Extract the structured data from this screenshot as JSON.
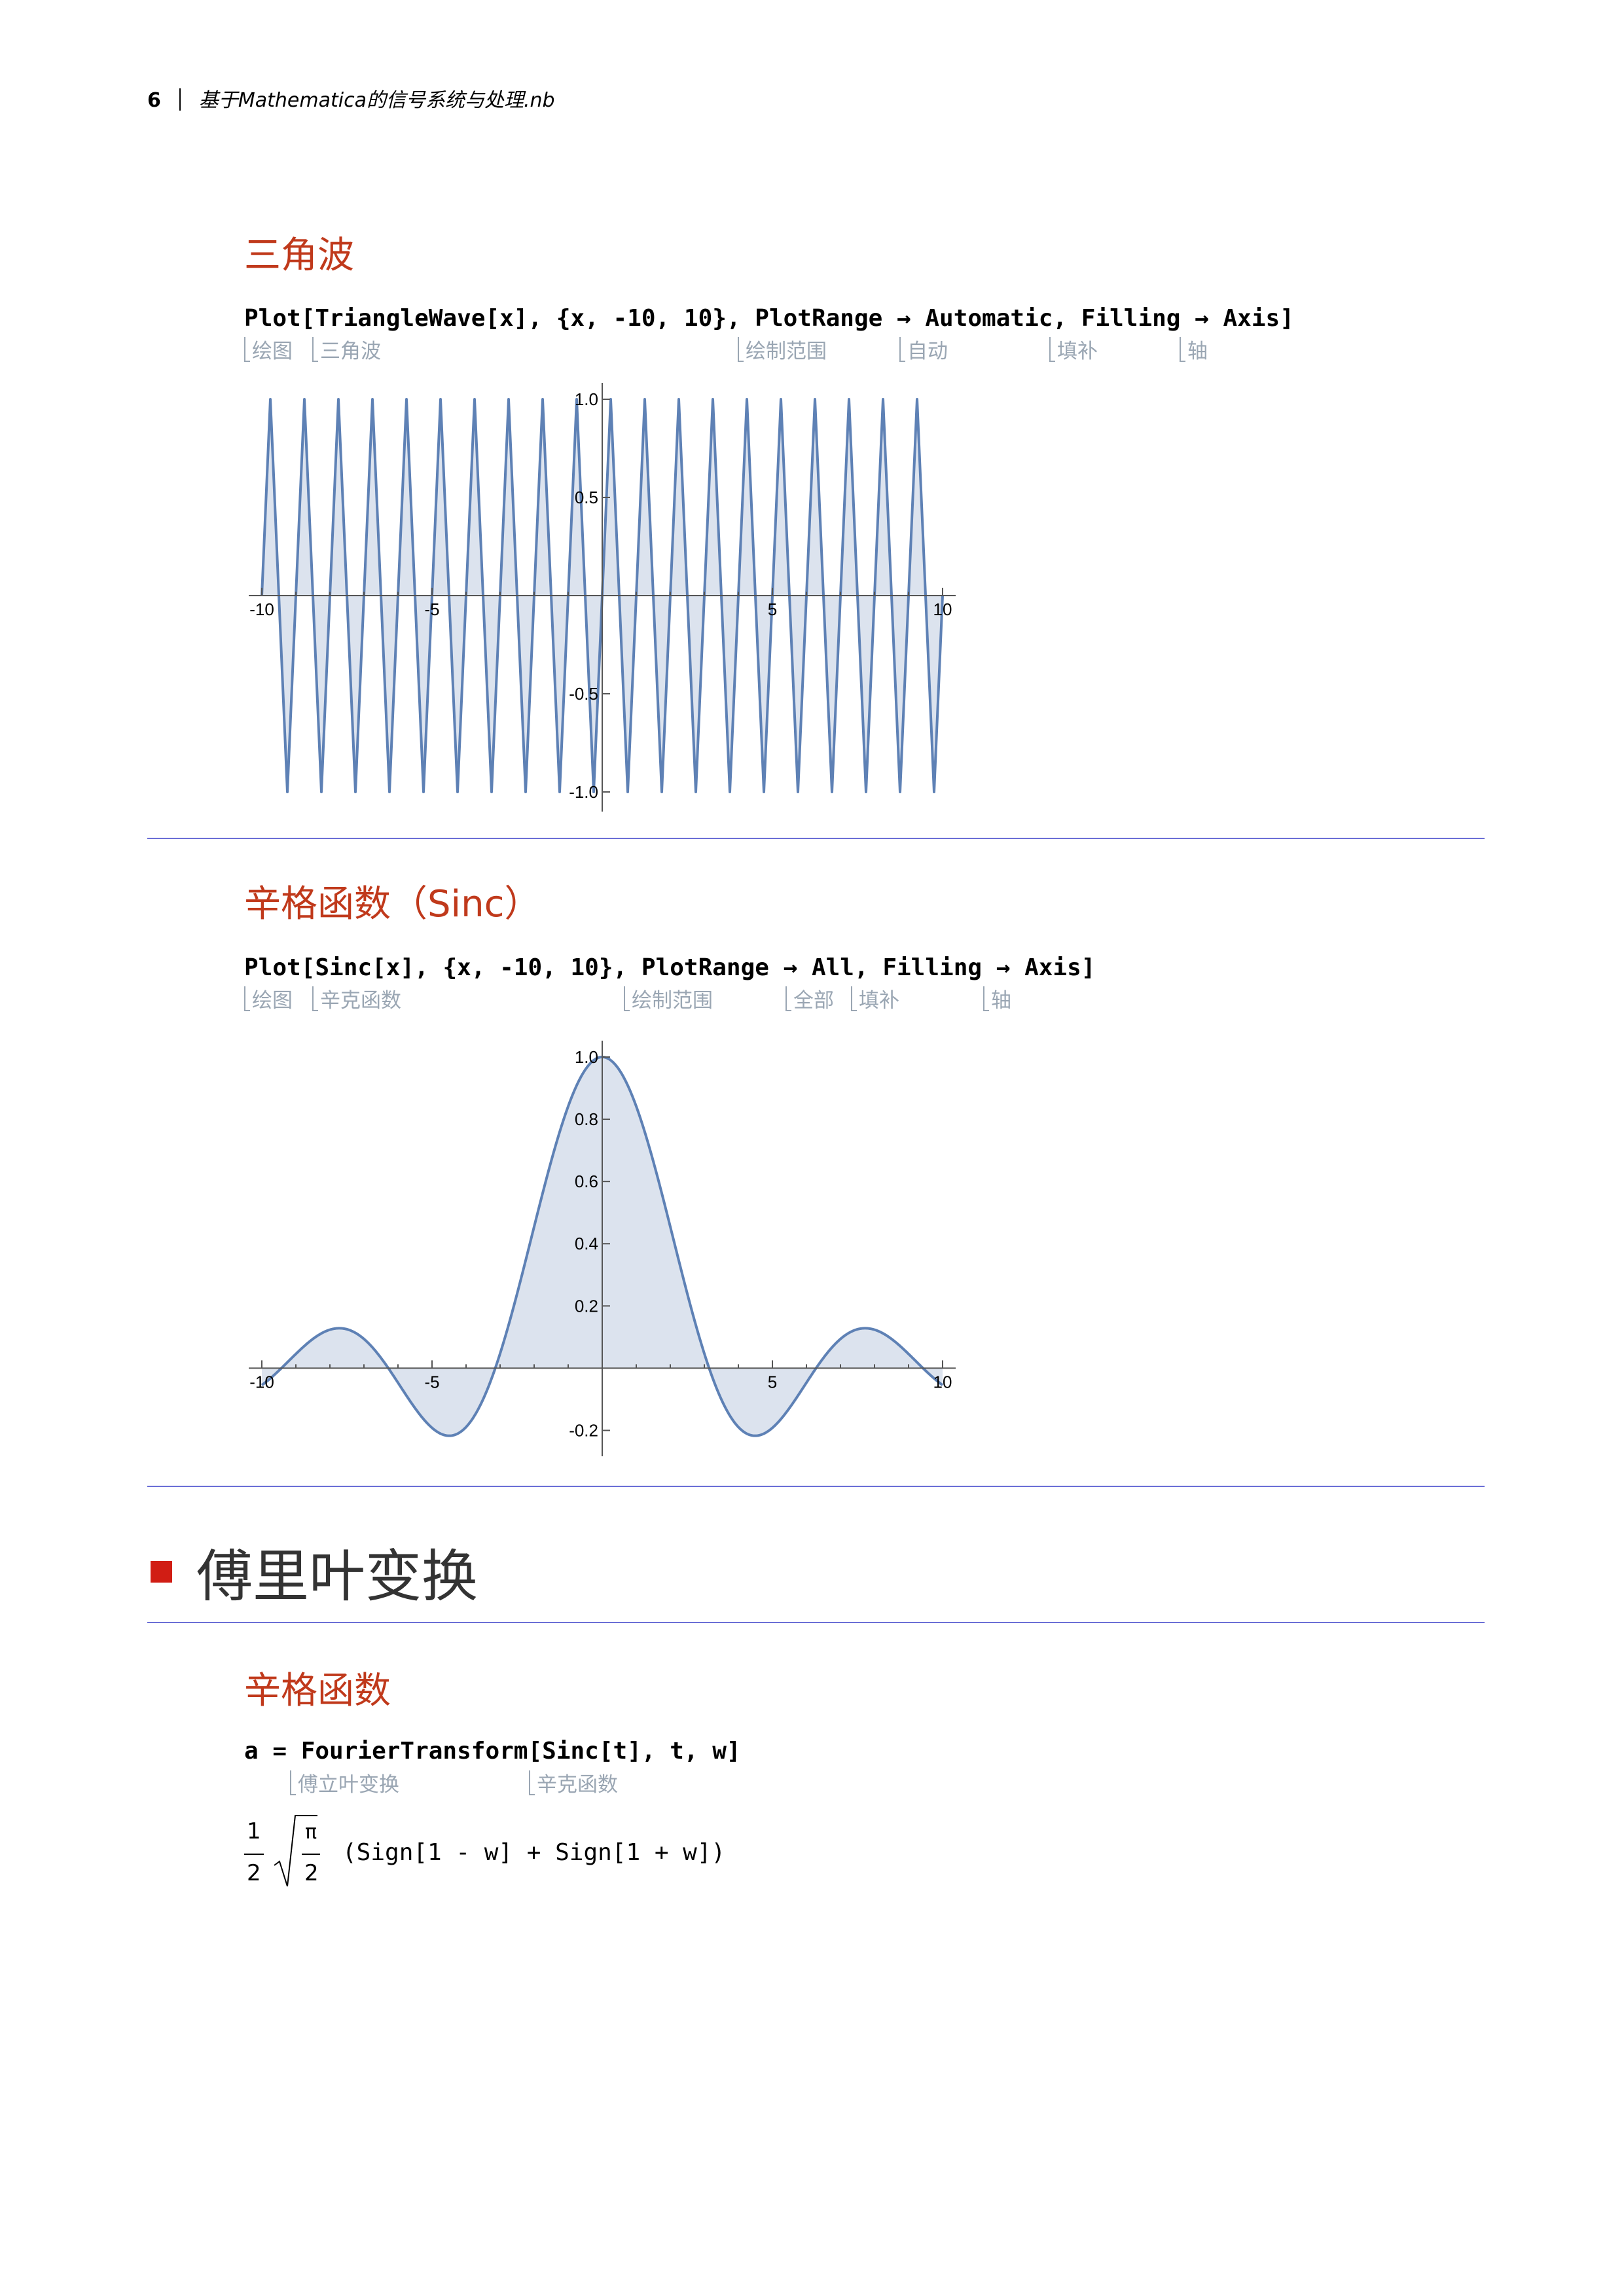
{
  "header": {
    "page_number": "6",
    "notebook_title": "基于Mathematica的信号系统与处理.nb"
  },
  "triangle": {
    "heading": "三角波",
    "code": {
      "plot": "Plot",
      "body": "[TriangleWave[x], {x, -10, 10}, PlotRange → Automatic, Filling → Axis]"
    },
    "annotations": [
      "绘图",
      "三角波",
      "绘制范围",
      "自动",
      "填补",
      "轴"
    ]
  },
  "sinc": {
    "heading": "辛格函数（Sinc）",
    "code": {
      "plot": "Plot",
      "body": "[Sinc[x], {x, -10, 10}, PlotRange → All, Filling → Axis]"
    },
    "annotations": [
      "绘图",
      "辛克函数",
      "绘制范围",
      "全部",
      "填补",
      "轴"
    ]
  },
  "fourier": {
    "section_title": "傅里叶变换",
    "heading": "辛格函数",
    "code": "a = FourierTransform[Sinc[t], t, w]",
    "annotations": [
      "傅立叶变换",
      "辛克函数"
    ],
    "result": {
      "frac1_num": "1",
      "frac1_den": "2",
      "frac2_num": "π",
      "frac2_den": "2",
      "expr": "(Sign[1 - w] + Sign[1 + w])"
    }
  },
  "chart_data": [
    {
      "type": "line",
      "function": "TriangleWave[x]",
      "xlim": [
        -10,
        10
      ],
      "ylim": [
        -1.0,
        1.0
      ],
      "filling": "axis",
      "period": 1,
      "x": [
        -10,
        -9.75,
        -9.25,
        -8.75,
        -8.25,
        -7.75,
        -7.25,
        -6.75,
        -6.25,
        -5.75,
        -5.25,
        -4.75,
        -4.25,
        -3.75,
        -3.25,
        -2.75,
        -2.25,
        -1.75,
        -1.25,
        -0.75,
        -0.25,
        0.25,
        0.75,
        1.25,
        1.75,
        2.25,
        2.75,
        3.25,
        3.75,
        4.25,
        4.75,
        5.25,
        5.75,
        6.25,
        6.75,
        7.25,
        7.75,
        8.25,
        8.75,
        9.25,
        9.75,
        10
      ],
      "y": [
        0,
        1,
        -1,
        1,
        -1,
        1,
        -1,
        1,
        -1,
        1,
        -1,
        1,
        -1,
        1,
        -1,
        1,
        -1,
        1,
        -1,
        1,
        -1,
        1,
        -1,
        1,
        -1,
        1,
        -1,
        1,
        -1,
        1,
        -1,
        1,
        -1,
        1,
        -1,
        1,
        -1,
        1,
        -1,
        1,
        -1,
        0
      ],
      "x_ticks": [
        "-10",
        "-5",
        "5",
        "10"
      ],
      "y_ticks": [
        "1.0",
        "0.5",
        "-0.5",
        "-1.0"
      ],
      "color": "#5e81b5",
      "fill_color": "#dce3ee"
    },
    {
      "type": "area",
      "function": "Sinc[x]",
      "xlim": [
        -10,
        10
      ],
      "ylim": [
        -0.22,
        1.0
      ],
      "filling": "axis",
      "x_ticks": [
        "-10",
        "-5",
        "5",
        "10"
      ],
      "y_ticks": [
        "1.0",
        "0.8",
        "0.6",
        "0.4",
        "0.2",
        "-0.2"
      ],
      "color": "#5e81b5",
      "fill_color": "#dce3ee"
    }
  ]
}
